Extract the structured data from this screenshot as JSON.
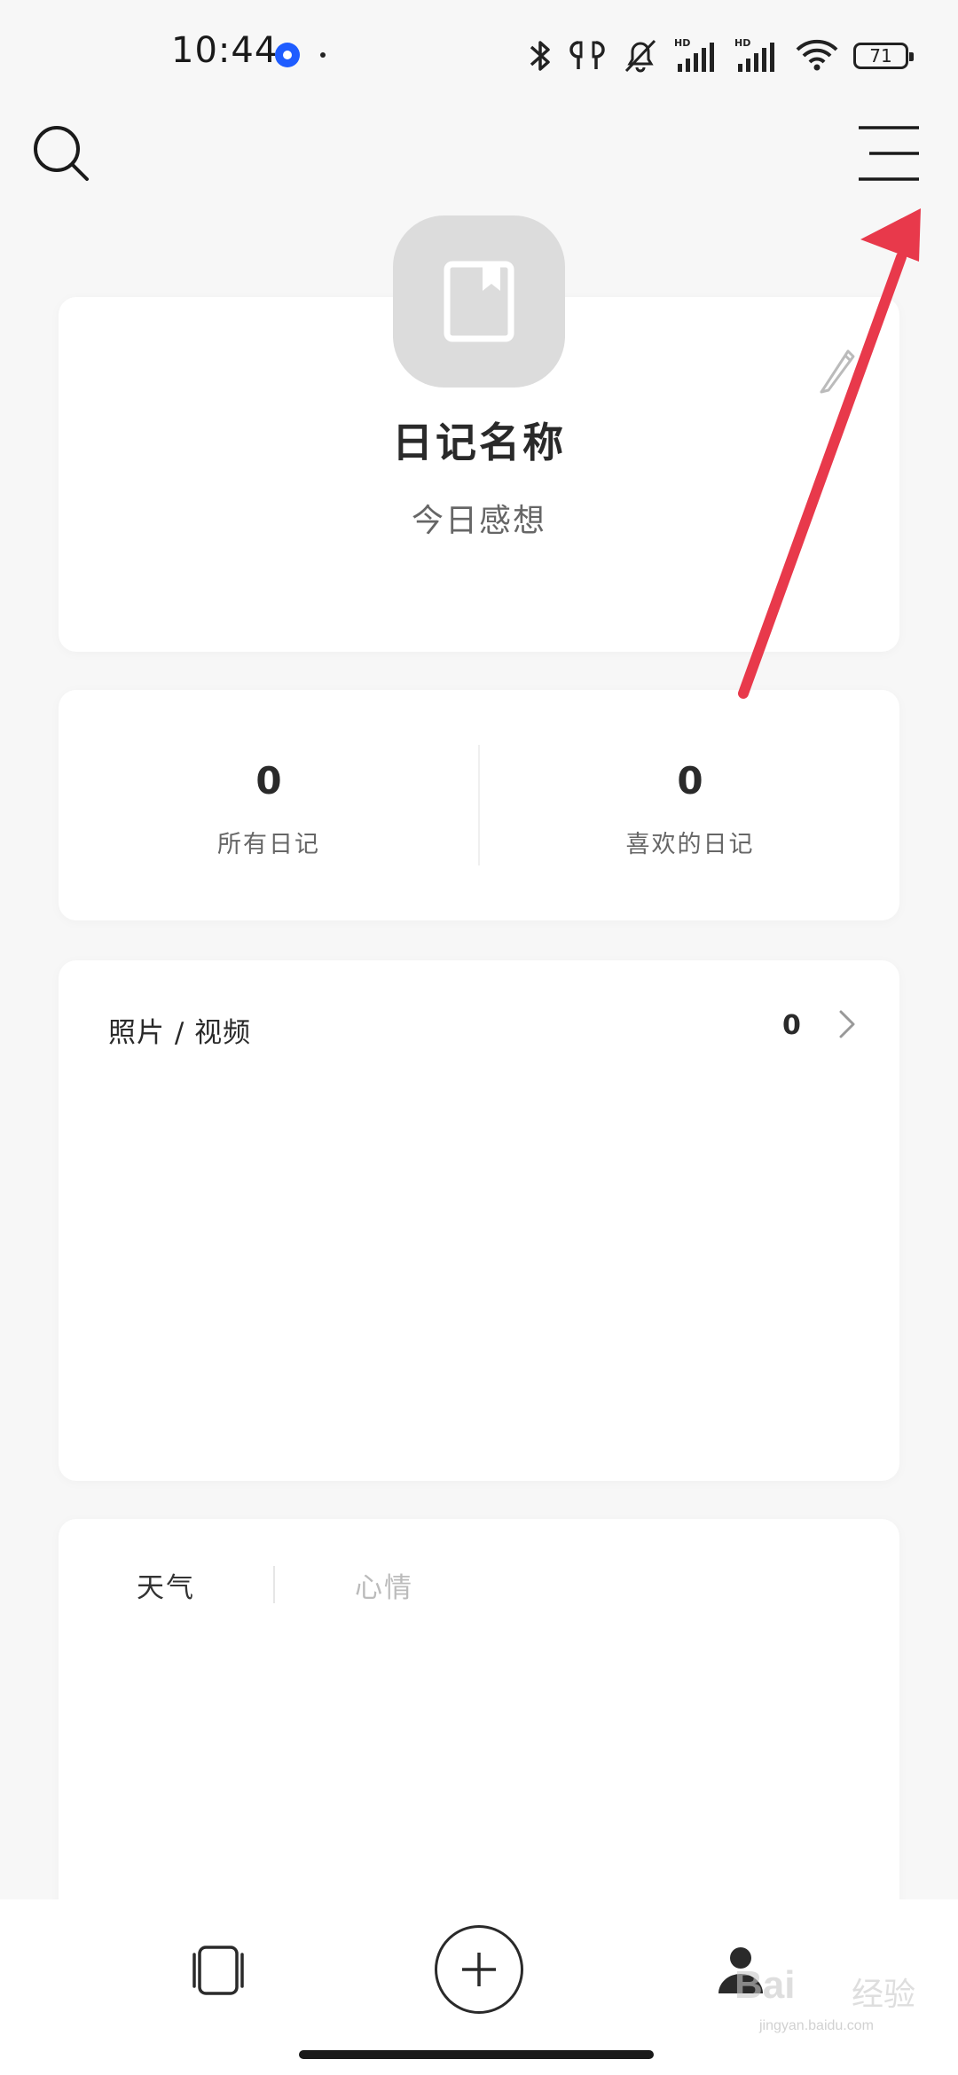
{
  "status_bar": {
    "time": "10:44",
    "battery": "71"
  },
  "icons": {
    "search": "search-icon",
    "menu": "menu-icon",
    "diary": "bookmark-book-icon",
    "edit": "pencil-icon",
    "chevron": "chevron-right-icon",
    "cards": "cards-icon",
    "add": "plus-icon",
    "profile": "person-icon"
  },
  "profile": {
    "name": "日记名称",
    "subtitle": "今日感想"
  },
  "stats": [
    {
      "value": "0",
      "label": "所有日记"
    },
    {
      "value": "0",
      "label": "喜欢的日记"
    }
  ],
  "media": {
    "title": "照片 / 视频",
    "count": "0"
  },
  "mood_tabs": [
    {
      "label": "天气"
    },
    {
      "label": "心情"
    }
  ],
  "colors": {
    "background": "#f7f7f7",
    "card": "#ffffff",
    "annotation_arrow": "#e8394b",
    "app_indicator": "#1e5cff"
  },
  "watermark": {
    "brand": "Bai",
    "brand_cn": "经验",
    "url": "jingyan.baidu.com"
  }
}
